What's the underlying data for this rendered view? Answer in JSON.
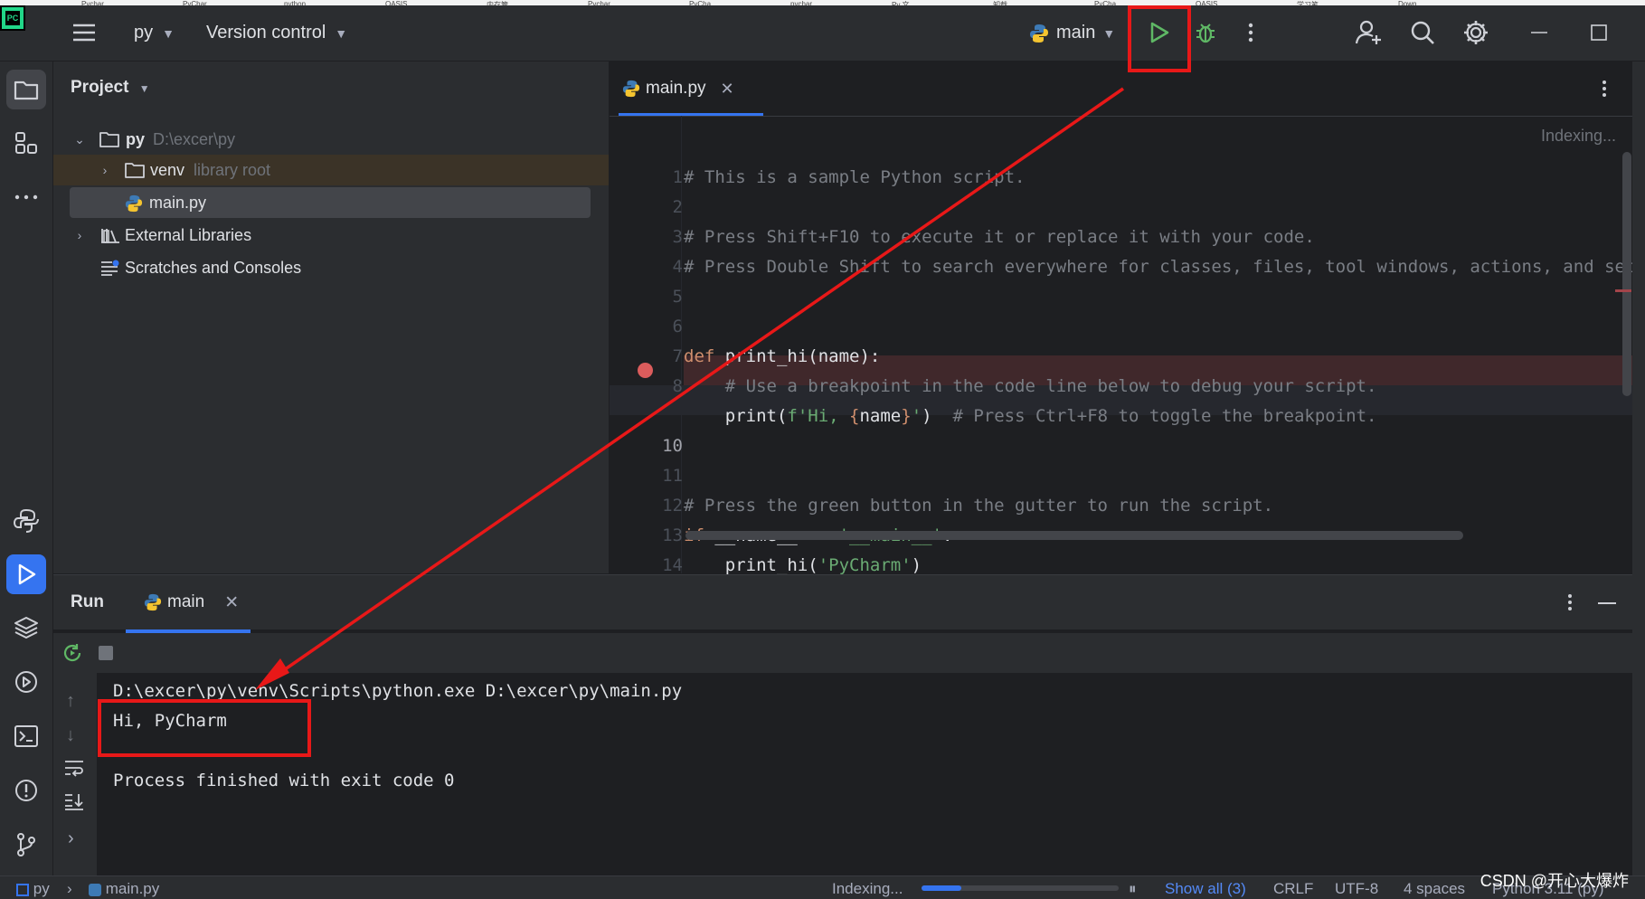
{
  "browser_tabs": [
    "Pychar",
    "PyChar",
    "python",
    "OASIS",
    "内存管",
    "Pychar",
    "PyCha",
    "pychar",
    "Py 文",
    "卸载",
    "PyCha",
    "OASIS",
    "学习笔",
    "Down"
  ],
  "titlebar": {
    "project": "py",
    "vcs": "Version control",
    "run_config": "main"
  },
  "project_panel": {
    "title": "Project",
    "tree": [
      {
        "label": "py",
        "hint": "D:\\excer\\py"
      },
      {
        "label": "venv",
        "hint": "library root"
      },
      {
        "label": "main.py",
        "hint": ""
      },
      {
        "label": "External Libraries",
        "hint": ""
      },
      {
        "label": "Scratches and Consoles",
        "hint": ""
      }
    ]
  },
  "editor": {
    "tab": "main.py",
    "status": "Indexing...",
    "lines": [
      {
        "n": "1",
        "parts": [
          {
            "c": "comment",
            "t": "# This is a sample Python script."
          }
        ]
      },
      {
        "n": "2",
        "parts": []
      },
      {
        "n": "3",
        "parts": [
          {
            "c": "comment",
            "t": "# Press Shift+F10 to execute it or replace it with your code."
          }
        ]
      },
      {
        "n": "4",
        "parts": [
          {
            "c": "comment",
            "t": "# Press Double Shift to search everywhere for classes, files, tool windows, actions, and settings."
          }
        ]
      },
      {
        "n": "5",
        "parts": []
      },
      {
        "n": "6",
        "parts": []
      },
      {
        "n": "7",
        "parts": [
          {
            "c": "kw",
            "t": "def "
          },
          {
            "c": "fn",
            "t": "print_hi(name):"
          }
        ]
      },
      {
        "n": "8",
        "parts": [
          {
            "c": "comment",
            "t": "    # Use a breakpoint in the code line below to debug your script."
          }
        ]
      },
      {
        "n": "",
        "parts": [
          {
            "c": "fn",
            "t": "    print("
          },
          {
            "c": "str",
            "t": "f'Hi, "
          },
          {
            "c": "kw",
            "t": "{"
          },
          {
            "c": "fn",
            "t": "name"
          },
          {
            "c": "kw",
            "t": "}"
          },
          {
            "c": "str",
            "t": "'"
          },
          {
            "c": "fn",
            "t": ")  "
          },
          {
            "c": "comment",
            "t": "# Press Ctrl+F8 to toggle the breakpoint."
          }
        ]
      },
      {
        "n": "10",
        "parts": []
      },
      {
        "n": "11",
        "parts": []
      },
      {
        "n": "12",
        "parts": [
          {
            "c": "comment",
            "t": "# Press the green button in the gutter to run the script."
          }
        ]
      },
      {
        "n": "13",
        "parts": [
          {
            "c": "kw",
            "t": "if "
          },
          {
            "c": "fn",
            "t": "__name__ == "
          },
          {
            "c": "str",
            "t": "'__main__'"
          },
          {
            "c": "fn",
            "t": ":"
          }
        ]
      },
      {
        "n": "14",
        "parts": [
          {
            "c": "fn",
            "t": "    print_hi("
          },
          {
            "c": "str",
            "t": "'PyCharm'"
          },
          {
            "c": "fn",
            "t": ")"
          }
        ]
      }
    ]
  },
  "run_panel": {
    "title": "Run",
    "tab": "main",
    "console": [
      "D:\\excer\\py\\venv\\Scripts\\python.exe D:\\excer\\py\\main.py",
      "Hi, PyCharm",
      "",
      "Process finished with exit code 0"
    ]
  },
  "statusbar": {
    "crumb_project": "py",
    "crumb_file": "main.py",
    "indexing": "Indexing...",
    "show_all": "Show all (3)",
    "line_sep": "CRLF",
    "encoding": "UTF-8",
    "indent": "4 spaces",
    "interpreter": "Python 3.11 (py)"
  },
  "watermark": "CSDN @开心大爆炸",
  "colors": {
    "accent": "#3574f0",
    "highlight_box": "#e81818",
    "run_green": "#5fb865"
  }
}
